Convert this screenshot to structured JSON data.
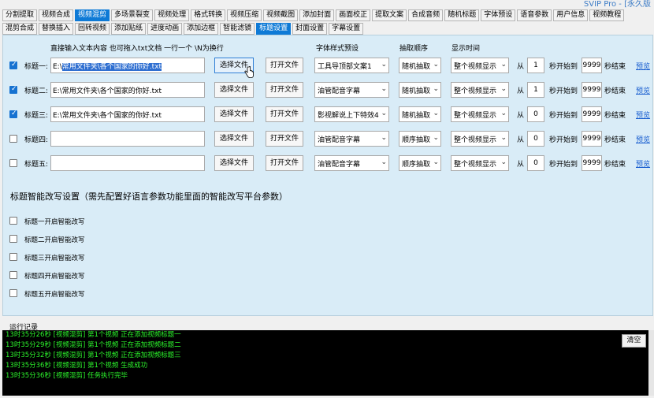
{
  "app": {
    "title": "SVIP Pro - [永久版"
  },
  "tabs_row1": [
    "分割提取",
    "视频合成",
    "视频混剪",
    "多场景裂变",
    "视频处理",
    "格式转换",
    "视频压缩",
    "视频截图",
    "添加封面",
    "画面校正",
    "提取文案",
    "合成音频",
    "随机标题",
    "字体预设",
    "语音参数",
    "用户信息",
    "视频教程"
  ],
  "tabs_row2": [
    "混剪合成",
    "替换插入",
    "回转视频",
    "添加贴纸",
    "进度动画",
    "添加边框",
    "智能滤镜",
    "标题设置",
    "封面设置",
    "字幕设置"
  ],
  "headers": {
    "input": "直接输入文本内容  也可拖入txt文档  一行一个  \\N为换行",
    "font": "字体样式预设",
    "order": "抽取顺序",
    "display": "显示时间"
  },
  "rows": [
    {
      "label": "标题一:",
      "checked": true,
      "input_prefix": "E:\\",
      "input_selected": "常用文件夹\\各个国家的你好.txt",
      "select_btn": "选择文件",
      "open_btn": "打开文件",
      "font": "工具导顶部文案1",
      "order": "随机抽取",
      "display": "整个视频显示",
      "from": "从",
      "start": "1",
      "start_suffix": "秒开始到",
      "end": "9999",
      "end_suffix": "秒结束",
      "preview": "预览"
    },
    {
      "label": "标题二:",
      "checked": true,
      "input": "E:\\常用文件夹\\各个国家的你好.txt",
      "select_btn": "选择文件",
      "open_btn": "打开文件",
      "font": "油管配音字幕",
      "order": "随机抽取",
      "display": "整个视频显示",
      "from": "从",
      "start": "1",
      "start_suffix": "秒开始到",
      "end": "9999",
      "end_suffix": "秒结束",
      "preview": "预览"
    },
    {
      "label": "标题三:",
      "checked": true,
      "input": "E:\\常用文件夹\\各个国家的你好.txt",
      "select_btn": "选择文件",
      "open_btn": "打开文件",
      "font": "影视解说上下特效4",
      "order": "随机抽取",
      "display": "整个视频显示",
      "from": "从",
      "start": "0",
      "start_suffix": "秒开始到",
      "end": "9999",
      "end_suffix": "秒结束",
      "preview": "预览"
    },
    {
      "label": "标题四:",
      "checked": false,
      "input": "",
      "select_btn": "选择文件",
      "open_btn": "打开文件",
      "font": "油管配音字幕",
      "order": "顺序抽取",
      "display": "整个视频显示",
      "from": "从",
      "start": "0",
      "start_suffix": "秒开始到",
      "end": "9999",
      "end_suffix": "秒结束",
      "preview": "预览"
    },
    {
      "label": "标题五:",
      "checked": false,
      "input": "",
      "select_btn": "选择文件",
      "open_btn": "打开文件",
      "font": "油管配音字幕",
      "order": "顺序抽取",
      "display": "整个视频显示",
      "from": "从",
      "start": "0",
      "start_suffix": "秒开始到",
      "end": "9999",
      "end_suffix": "秒结束",
      "preview": "预览"
    }
  ],
  "smart": {
    "title": "标题智能改写设置（需先配置好语言参数功能里面的智能改写平台参数）",
    "options": [
      "标题一开启智能改写",
      "标题二开启智能改写",
      "标题三开启智能改写",
      "标题四开启智能改写",
      "标题五开启智能改写"
    ]
  },
  "log": {
    "title": "运行记录",
    "clear": "清空",
    "lines": [
      "13时35分26秒 [视频混剪] 第1个视频 正在添加视频标题一",
      "13时35分29秒 [视频混剪] 第1个视频 正在添加视频标题二",
      "13时35分32秒 [视频混剪] 第1个视频 正在添加视频标题三",
      "13时35分36秒 [视频混剪] 第1个视频 生成成功",
      "13时35分36秒 [视频混剪] 任务执行完毕"
    ]
  }
}
